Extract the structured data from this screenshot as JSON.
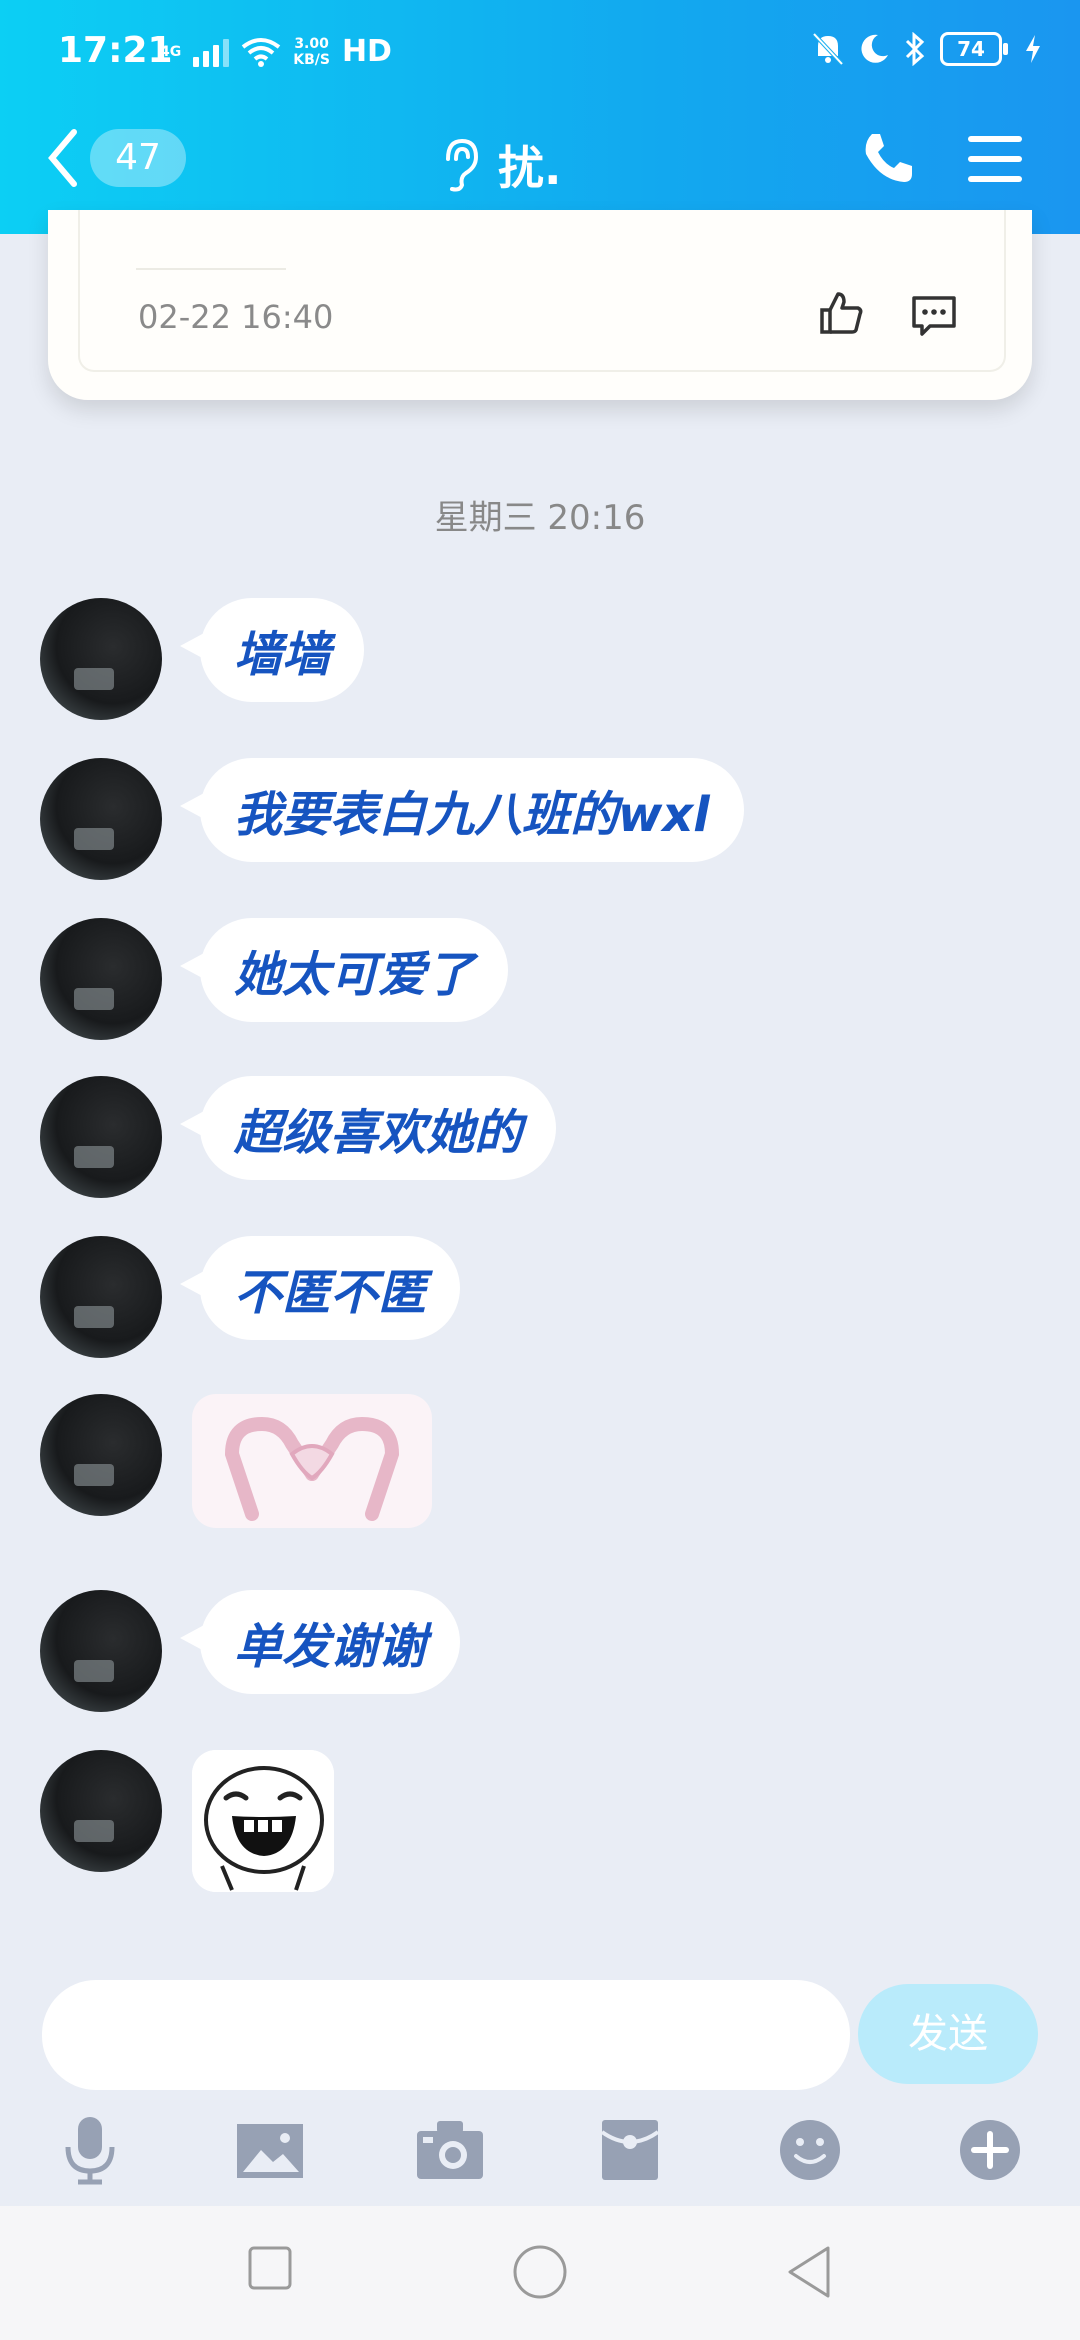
{
  "status_bar": {
    "time": "17:21",
    "network": "4G",
    "speed_value": "3.00",
    "speed_unit": "KB/S",
    "hd": "HD",
    "battery": "74"
  },
  "nav": {
    "unread_count": "47",
    "title": "扰."
  },
  "post": {
    "time": "02-22 16:40"
  },
  "time_divider": "星期三 20:16",
  "messages": [
    {
      "type": "text",
      "text": "墙墙"
    },
    {
      "type": "text",
      "text": "我要表白九八班的wxl"
    },
    {
      "type": "text",
      "text": "她太可爱了"
    },
    {
      "type": "text",
      "text": "超级喜欢她的"
    },
    {
      "type": "text",
      "text": "不匿不匿"
    },
    {
      "type": "sticker",
      "icon": "heart-hands-sticker"
    },
    {
      "type": "text",
      "text": "单发谢谢"
    },
    {
      "type": "sticker",
      "icon": "laughing-face-sticker"
    }
  ],
  "input": {
    "value": "",
    "send_label": "发送"
  },
  "toolbar": [
    "mic-icon",
    "image-icon",
    "camera-icon",
    "red-packet-icon",
    "emoji-icon",
    "plus-icon"
  ],
  "colors": {
    "header_start": "#0ccff4",
    "header_end": "#1a96f0",
    "bubble_text": "#1654c0",
    "send_button": "#b9ebfb",
    "background": "#e9edf5"
  }
}
